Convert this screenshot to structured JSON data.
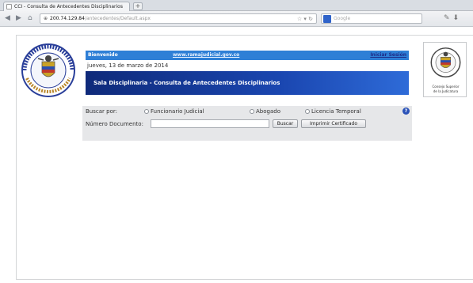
{
  "browser": {
    "tab_title": "CCI - Consulta de Antecedentes Disciplinarios",
    "new_tab": "+",
    "url_host": "200.74.129.84",
    "url_path": "/antecedentes/Default.aspx",
    "search_placeholder": "Google"
  },
  "header": {
    "welcome": "Bienvenido",
    "site_link": "www.ramajudicial.gov.co",
    "logout": "Iniciar Sesión",
    "date": "jueves, 13 de marzo de 2014",
    "banner_title": "Sala Disciplinaria - Consulta de Antecedentes Disciplinarios"
  },
  "form": {
    "search_by_label": "Buscar por:",
    "options": [
      "Funcionario Judicial",
      "Abogado",
      "Licencia Temporal"
    ],
    "doc_label": "Número Documento:",
    "doc_value": "",
    "search_button": "Buscar",
    "print_button": "Imprimir Certificado"
  },
  "logos": {
    "right_caption_line1": "Consejo Superior",
    "right_caption_line2": "de la Judicatura"
  }
}
